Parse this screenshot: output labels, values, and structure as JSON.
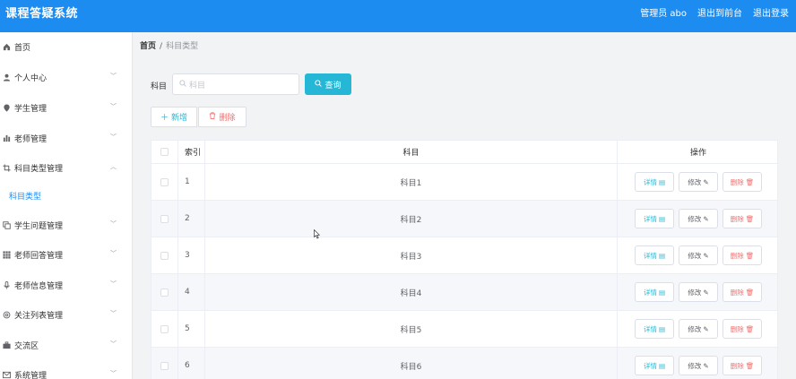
{
  "header": {
    "title": "课程答疑系统",
    "user": "管理员 abo",
    "back_frontend": "退出到前台",
    "logout": "退出登录"
  },
  "sidebar": {
    "items": [
      {
        "label": "首页",
        "icon": "home-icon"
      },
      {
        "label": "个人中心",
        "icon": "user-icon"
      },
      {
        "label": "学生管理",
        "icon": "location-icon"
      },
      {
        "label": "老师管理",
        "icon": "chart-icon"
      },
      {
        "label": "科目类型管理",
        "icon": "crop-icon"
      },
      {
        "label": "科目类型",
        "icon": ""
      },
      {
        "label": "学生问题管理",
        "icon": "copy-icon"
      },
      {
        "label": "老师回答管理",
        "icon": "grid-icon"
      },
      {
        "label": "老师信息管理",
        "icon": "mic-icon"
      },
      {
        "label": "关注列表管理",
        "icon": "settings-icon"
      },
      {
        "label": "交流区",
        "icon": "briefcase-icon"
      },
      {
        "label": "系统管理",
        "icon": "message-icon"
      }
    ]
  },
  "breadcrumb": {
    "home": "首页",
    "sep": "/",
    "current": "科目类型"
  },
  "filter": {
    "label": "科目",
    "placeholder": "科目",
    "query_label": "查询"
  },
  "toolbar": {
    "add_label": "新增",
    "delete_label": "删除"
  },
  "table": {
    "columns": {
      "index": "索引",
      "subject": "科目",
      "ops": "操作"
    },
    "ops": {
      "detail": "详情",
      "edit": "修改",
      "remove": "删除"
    },
    "rows": [
      {
        "index": "1",
        "subject": "科目1"
      },
      {
        "index": "2",
        "subject": "科目2"
      },
      {
        "index": "3",
        "subject": "科目3"
      },
      {
        "index": "4",
        "subject": "科目4"
      },
      {
        "index": "5",
        "subject": "科目5"
      },
      {
        "index": "6",
        "subject": "科目6"
      }
    ]
  },
  "colors": {
    "primary": "#1d8cf0",
    "accent": "#26b7d6",
    "danger": "#f56c6c"
  }
}
